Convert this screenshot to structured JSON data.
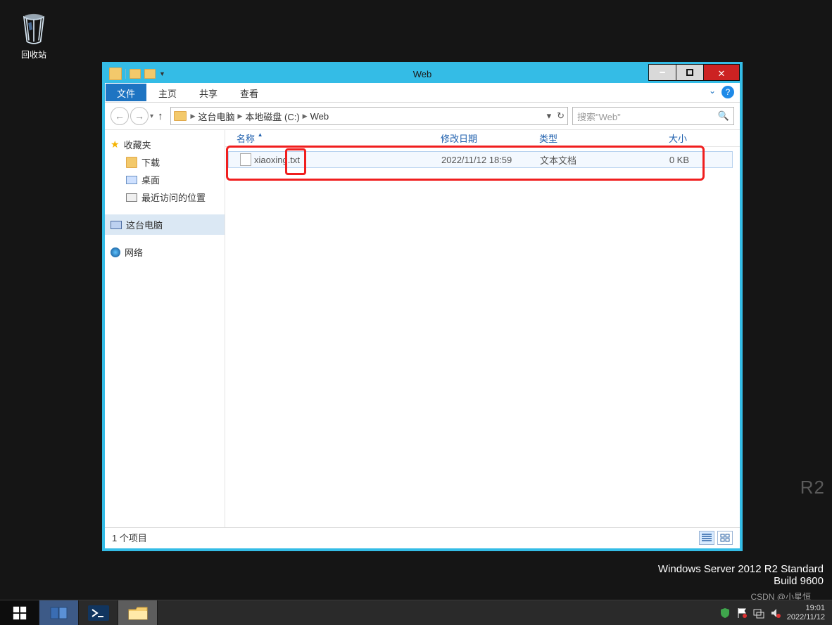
{
  "desktop": {
    "recycle_bin_label": "回收站"
  },
  "window": {
    "title": "Web",
    "ribbon": {
      "file": "文件",
      "tabs": [
        "主页",
        "共享",
        "查看"
      ]
    },
    "breadcrumb": {
      "items": [
        "这台电脑",
        "本地磁盘 (C:)",
        "Web"
      ]
    },
    "search_placeholder": "搜索\"Web\"",
    "columns": {
      "name": "名称",
      "date": "修改日期",
      "type": "类型",
      "size": "大小"
    },
    "nav_pane": {
      "favorites_label": "收藏夹",
      "favorites_items": [
        "下载",
        "桌面",
        "最近访问的位置"
      ],
      "this_pc_label": "这台电脑",
      "network_label": "网络"
    },
    "files": [
      {
        "name": "xiaoxing.txt",
        "date": "2022/11/12 18:59",
        "type": "文本文档",
        "size": "0 KB"
      }
    ],
    "status": "1 个项目"
  },
  "os": {
    "edition": "Windows Server 2012 R2 Standard",
    "build": "Build 9600",
    "r2": "R2"
  },
  "tray": {
    "time": "19:01",
    "date": "2022/11/12"
  },
  "watermark": "CSDN @小星恒"
}
